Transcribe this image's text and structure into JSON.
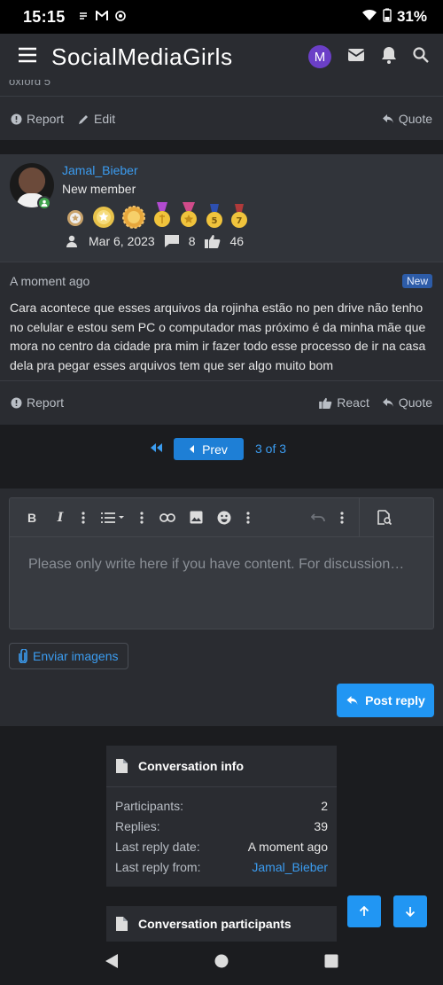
{
  "status_bar": {
    "time": "15:15",
    "battery": "31%"
  },
  "app_bar": {
    "title": "SocialMediaGirls",
    "avatar_letter": "M"
  },
  "prev_message": {
    "cut_text": "oxford 5",
    "actions": {
      "report": "Report",
      "edit": "Edit",
      "quote": "Quote"
    }
  },
  "message": {
    "username": "Jamal_Bieber",
    "user_title": "New member",
    "joined": "Mar 6, 2023",
    "messages_count": "8",
    "reactions_count": "46",
    "time": "A moment ago",
    "badge": "New",
    "body": "Cara acontece que esses arquivos da rojinha estão no pen drive não tenho no celular e estou sem PC o computador mas próximo é da minha mãe que mora no centro da cidade pra mim ir fazer todo esse processo de ir na casa dela pra pegar esses arquivos tem que ser algo muito bom",
    "actions": {
      "report": "Report",
      "react": "React",
      "quote": "Quote"
    }
  },
  "pagination": {
    "prev_label": "Prev",
    "info": "3 of 3"
  },
  "editor": {
    "placeholder": "Please only write here if you have content. For discussion…",
    "attach_label": "Enviar imagens",
    "post_label": "Post reply"
  },
  "conversation_info": {
    "heading": "Conversation info",
    "rows": [
      {
        "label": "Participants:",
        "value": "2"
      },
      {
        "label": "Replies:",
        "value": "39"
      },
      {
        "label": "Last reply date:",
        "value": "A moment ago"
      },
      {
        "label": "Last reply from:",
        "value": "Jamal_Bieber"
      }
    ]
  },
  "participants_box": {
    "heading": "Conversation participants"
  },
  "colors": {
    "accent": "#2196f3",
    "link": "#3b9cf0",
    "panel": "#2a2c31",
    "background": "#1b1c1f"
  }
}
